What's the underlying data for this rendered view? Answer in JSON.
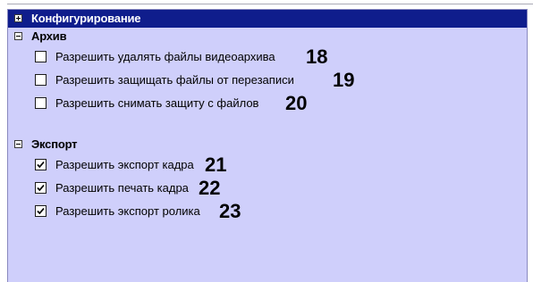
{
  "header": {
    "title": "Конфигурирование",
    "expander": "plus-box-icon"
  },
  "groups": [
    {
      "label": "Архив",
      "items": [
        {
          "label": "Разрешить удалять файлы видеоархива",
          "checked": false,
          "number": "18"
        },
        {
          "label": "Разрешить защищать файлы от перезаписи",
          "checked": false,
          "number": "19"
        },
        {
          "label": "Разрешить снимать защиту с файлов",
          "checked": false,
          "number": "20"
        }
      ]
    },
    {
      "label": "Экспорт",
      "items": [
        {
          "label": "Разрешить экспорт кадра",
          "checked": true,
          "number": "21"
        },
        {
          "label": "Разрешить печать кадра",
          "checked": true,
          "number": "22"
        },
        {
          "label": "Разрешить экспорт ролика",
          "checked": true,
          "number": "23"
        }
      ]
    }
  ],
  "colors": {
    "panel_background": "#cfcffb",
    "header_background": "#0f1d8c",
    "header_text": "#ffffff"
  }
}
